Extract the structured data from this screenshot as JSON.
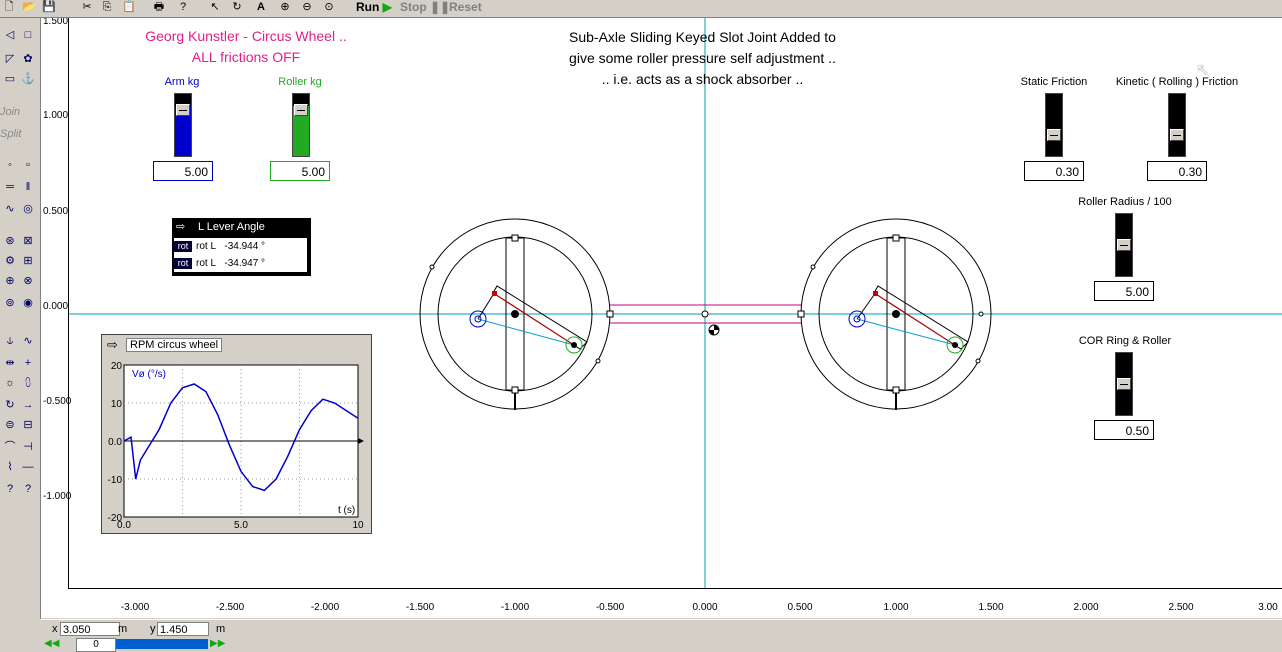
{
  "toolbar": {
    "run_label": "Run",
    "stop_label": "Stop",
    "reset_label": "Reset"
  },
  "palette": {
    "join_label": "Join",
    "split_label": "Split"
  },
  "canvas": {
    "title_left_line1": "Georg Kunstler - Circus Wheel ..",
    "title_left_line2": "ALL frictions OFF",
    "title_center_line1": "Sub-Axle Sliding Keyed Slot Joint Added to",
    "title_center_line2": "give some roller pressure self adjustment ..",
    "title_center_line3": ".. i.e. acts as a shock absorber .."
  },
  "sliders": {
    "arm": {
      "label": "Arm kg",
      "value": "5.00",
      "level": 0.8,
      "color": "#0000cc"
    },
    "roller": {
      "label": "Roller kg",
      "value": "5.00",
      "level": 0.8,
      "color": "#22aa22"
    },
    "static": {
      "label": "Static Friction",
      "value": "0.30",
      "level": 0.3
    },
    "kinetic": {
      "label": "Kinetic ( Rolling ) Friction",
      "value": "0.30",
      "level": 0.3
    },
    "radius": {
      "label": "Roller Radius / 100",
      "value": "5.00",
      "level": 0.5
    },
    "cor": {
      "label": "COR Ring & Roller",
      "value": "0.50",
      "level": 0.5
    }
  },
  "meter": {
    "title": "L Lever Angle",
    "rows": [
      {
        "tag": "rot",
        "label": "rot L",
        "value": "-34.944 °"
      },
      {
        "tag": "rot",
        "label": "rot L",
        "value": "-34.947 °"
      }
    ]
  },
  "graph": {
    "title": "RPM circus wheel",
    "ylabel": "Vø (°/s)",
    "xlabel": "t (s)",
    "yticks": [
      "20",
      "10",
      "0.0",
      "-10",
      "-20"
    ],
    "xticks": [
      "0.0",
      "5.0",
      "10"
    ]
  },
  "vruler": [
    "1.500",
    "1.000",
    "0.500",
    "0.000",
    "-0.500",
    "-1.000"
  ],
  "hruler": [
    "-3.000",
    "-2.500",
    "-2.000",
    "-1.500",
    "-1.000",
    "-0.500",
    "0.000",
    "0.500",
    "1.000",
    "1.500",
    "2.000",
    "2.500",
    "3.00"
  ],
  "status": {
    "x_label": "x",
    "x_value": "3.050",
    "x_unit": "m",
    "y_label": "y",
    "y_value": "1.450",
    "y_unit": "m",
    "frame_value": "0"
  },
  "chart_data": {
    "type": "line",
    "title": "RPM circus wheel",
    "xlabel": "t (s)",
    "ylabel": "Vø (°/s)",
    "xlim": [
      0,
      10
    ],
    "ylim": [
      -20,
      20
    ],
    "grid": true,
    "series": [
      {
        "x": [
          0.0,
          0.3,
          0.5,
          0.7,
          1.0,
          1.5,
          2.0,
          2.5,
          3.0,
          3.5,
          4.0,
          4.5,
          5.0,
          5.5,
          6.0,
          6.5,
          7.0,
          7.5,
          8.0,
          8.5,
          9.0,
          9.5,
          10.0
        ],
        "y": [
          0,
          1,
          -10,
          -5,
          -2,
          3,
          10,
          14,
          15,
          13,
          7,
          -1,
          -8,
          -12,
          -13,
          -10,
          -4,
          3,
          8,
          11,
          10,
          8,
          6
        ]
      }
    ]
  }
}
